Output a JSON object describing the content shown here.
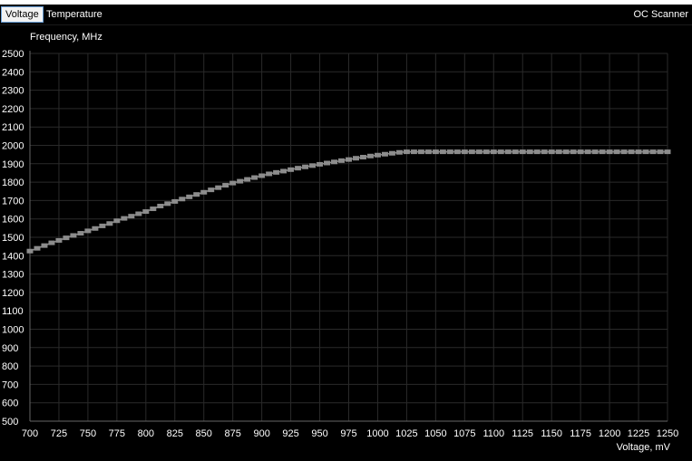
{
  "tabs": {
    "voltage": "Voltage",
    "temperature": "Temperature",
    "oc_scanner": "OC Scanner"
  },
  "chart_data": {
    "type": "line",
    "ylabel": "Frequency, MHz",
    "xlabel": "Voltage, mV",
    "xlim": [
      700,
      1250
    ],
    "ylim": [
      500,
      2500
    ],
    "xticks": [
      700,
      725,
      750,
      775,
      800,
      825,
      850,
      875,
      900,
      925,
      950,
      975,
      1000,
      1025,
      1050,
      1075,
      1100,
      1125,
      1150,
      1175,
      1200,
      1225,
      1250
    ],
    "yticks": [
      500,
      600,
      700,
      800,
      900,
      1000,
      1100,
      1200,
      1300,
      1400,
      1500,
      1600,
      1700,
      1800,
      1900,
      2000,
      2100,
      2200,
      2300,
      2400,
      2500
    ],
    "grid": true,
    "colors": {
      "series": "#8c8c8c",
      "grid": "#2a2a2a",
      "axis": "#666666"
    },
    "series": [
      {
        "x": [
          700,
          706.25,
          712.5,
          718.75,
          725,
          731.25,
          737.5,
          743.75,
          750,
          756.25,
          762.5,
          768.75,
          775,
          781.25,
          787.5,
          793.75,
          800,
          806.25,
          812.5,
          818.75,
          825,
          831.25,
          837.5,
          843.75,
          850,
          856.25,
          862.5,
          868.75,
          875,
          881.25,
          887.5,
          893.75,
          900,
          906.25,
          912.5,
          918.75,
          925,
          931.25,
          937.5,
          943.75,
          950,
          956.25,
          962.5,
          968.75,
          975,
          981.25,
          987.5,
          993.75,
          1000,
          1006.25,
          1012.5,
          1018.75,
          1025,
          1031.25,
          1037.5,
          1043.75,
          1050,
          1056.25,
          1062.5,
          1068.75,
          1075,
          1081.25,
          1087.5,
          1093.75,
          1100,
          1106.25,
          1112.5,
          1118.75,
          1125,
          1131.25,
          1137.5,
          1143.75,
          1150,
          1156.25,
          1162.5,
          1168.75,
          1175,
          1181.25,
          1187.5,
          1193.75,
          1200,
          1206.25,
          1212.5,
          1218.75,
          1225,
          1231.25,
          1237.5,
          1243.75,
          1250
        ],
        "y": [
          1425,
          1440,
          1455,
          1470,
          1483,
          1497,
          1510,
          1522,
          1535,
          1548,
          1562,
          1575,
          1590,
          1603,
          1615,
          1628,
          1640,
          1655,
          1670,
          1683,
          1695,
          1708,
          1720,
          1733,
          1745,
          1758,
          1770,
          1783,
          1795,
          1805,
          1815,
          1825,
          1835,
          1845,
          1853,
          1860,
          1868,
          1876,
          1883,
          1890,
          1897,
          1904,
          1910,
          1917,
          1923,
          1930,
          1936,
          1942,
          1947,
          1952,
          1957,
          1962,
          1965,
          1965,
          1965,
          1965,
          1965,
          1965,
          1965,
          1965,
          1965,
          1965,
          1965,
          1965,
          1965,
          1965,
          1965,
          1965,
          1965,
          1965,
          1965,
          1965,
          1965,
          1965,
          1965,
          1965,
          1965,
          1965,
          1965,
          1965,
          1965,
          1965,
          1965,
          1965,
          1965,
          1965,
          1965,
          1965,
          1965
        ]
      }
    ]
  }
}
